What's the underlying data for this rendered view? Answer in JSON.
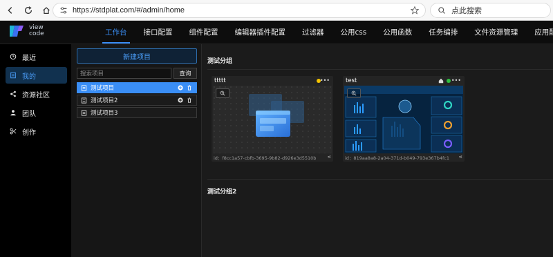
{
  "browser": {
    "url": "https://stdplat.com/#/admin/home",
    "search_placeholder": "点此搜索"
  },
  "logo": {
    "line1": "view",
    "line2": "code"
  },
  "topnav": [
    {
      "label": "工作台",
      "active": true
    },
    {
      "label": "接口配置"
    },
    {
      "label": "组件配置"
    },
    {
      "label": "编辑器插件配置"
    },
    {
      "label": "过滤器"
    },
    {
      "label": "公用css"
    },
    {
      "label": "公用函数"
    },
    {
      "label": "任务编排"
    },
    {
      "label": "文件资源管理"
    },
    {
      "label": "应用配置"
    }
  ],
  "sidebar": {
    "items": [
      {
        "label": "最近",
        "icon": "clock-icon"
      },
      {
        "label": "我的",
        "icon": "document-icon",
        "active": true
      },
      {
        "label": "资源社区",
        "icon": "share-icon"
      },
      {
        "label": "团队",
        "icon": "user-icon"
      },
      {
        "label": "创作",
        "icon": "scissors-icon"
      }
    ]
  },
  "projects": {
    "new_button": "新建项目",
    "search_placeholder": "搜索项目",
    "search_button": "查询",
    "list": [
      {
        "name": "测试项目",
        "active": true
      },
      {
        "name": "测试项目2"
      },
      {
        "name": "测试项目3"
      }
    ]
  },
  "main": {
    "groups": [
      {
        "title": "测试分组",
        "cards": [
          {
            "title": "ttttt",
            "status_color": "#f5c400",
            "id_text": "id：f8cc1a57-cbfb-3695-9b82-d926e3d5510b"
          },
          {
            "title": "test",
            "status_color": "#30c040",
            "id_text": "id：819aa8a8-2a04-371d-b049-793e367b4fc1"
          }
        ]
      },
      {
        "title": "测试分组2",
        "cards": []
      }
    ]
  },
  "colors": {
    "accent": "#3a8ef6",
    "dark_bg": "#1b1b1b"
  }
}
